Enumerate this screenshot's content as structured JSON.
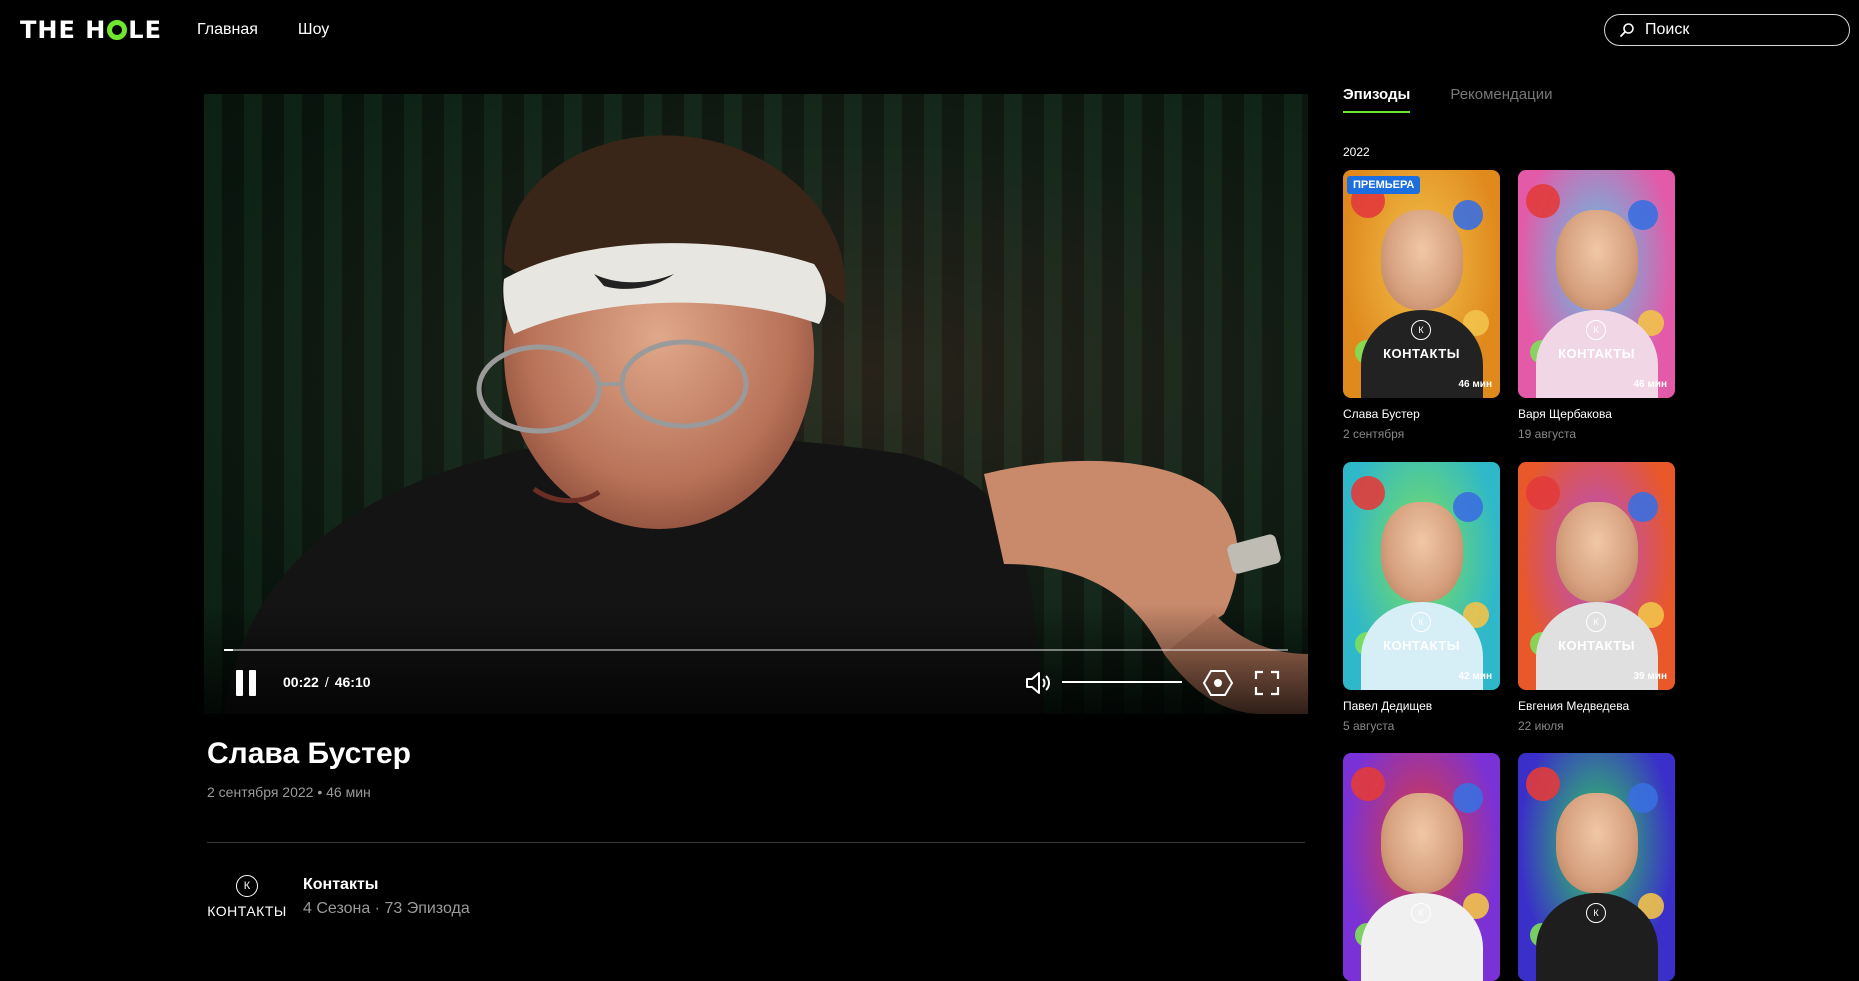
{
  "header": {
    "logo": {
      "left": "THE H",
      "right": "LE"
    },
    "nav": [
      "Главная",
      "Шоу"
    ],
    "search_placeholder": "Поиск"
  },
  "player": {
    "current_time": "00:22",
    "total_time": "46:10",
    "progress": 0.008,
    "volume": 1.0
  },
  "episode": {
    "title": "Слава Бустер",
    "meta": "2 сентября 2022 • 46 мин"
  },
  "show": {
    "logo_letter": "К",
    "logo_label": "КОНТАКТЫ",
    "name": "Контакты",
    "stats": "4 Сезона · 73 Эпизода"
  },
  "panel": {
    "tabs": [
      "Эпизоды",
      "Рекомендации"
    ],
    "year": "2022",
    "premiere_badge": "ПРЕМЬЕРА",
    "cards": [
      {
        "name": "Слава Бустер",
        "date": "2 сентября",
        "duration": "46 мин",
        "label": "КОНТАКТЫ",
        "bg": "#e08a1e",
        "accent": "#f2c24a",
        "shirt": "#222222"
      },
      {
        "name": "Варя Щербакова",
        "date": "19 августа",
        "duration": "46 мин",
        "label": "КОНТАКТЫ",
        "bg": "#e35aa8",
        "accent": "#57c8ea",
        "shirt": "#f1d7e6"
      },
      {
        "name": "Павел Дедищев",
        "date": "5 августа",
        "duration": "42 мин",
        "label": "КОНТАКТЫ",
        "bg": "#2fb8c9",
        "accent": "#7ee05a",
        "shirt": "#d6eef5"
      },
      {
        "name": "Евгения Медведева",
        "date": "22 июля",
        "duration": "39 мин",
        "label": "КОНТАКТЫ",
        "bg": "#e8582a",
        "accent": "#b34fd0",
        "shirt": "#e0e0e0"
      },
      {
        "name": "",
        "date": "",
        "duration": "",
        "label": "",
        "bg": "#7a32d6",
        "accent": "#e03a3a",
        "shirt": "#f0f0f0"
      },
      {
        "name": "",
        "date": "",
        "duration": "",
        "label": "",
        "bg": "#3a2fc9",
        "accent": "#2fd45a",
        "shirt": "#1e1e1e"
      }
    ]
  },
  "colors": {
    "accent": "#6ee72e",
    "badge": "#1d6fe0"
  }
}
